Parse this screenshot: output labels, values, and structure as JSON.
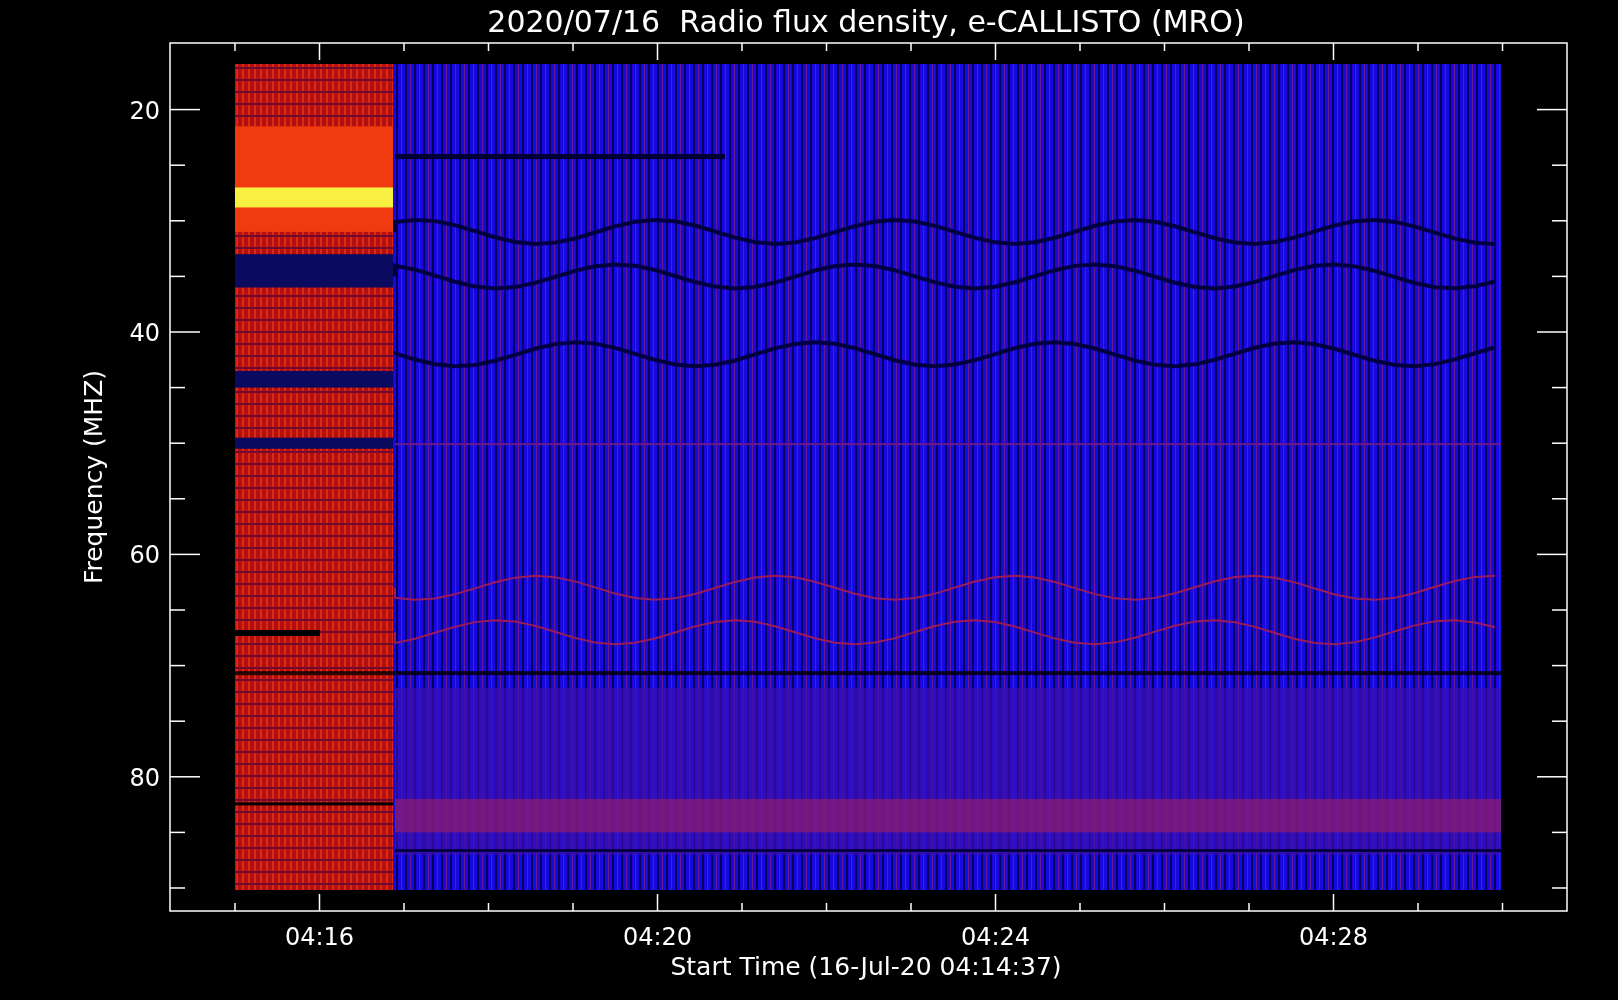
{
  "title": "2020/07/16  Radio flux density, e-CALLISTO (MRO)",
  "plot": {
    "xlabel": "Start Time (16-Jul-20 04:14:37)",
    "ylabel": "Frequency (MHZ)",
    "xticks": [
      {
        "label": "04:16"
      },
      {
        "label": "04:20"
      },
      {
        "label": "04:24"
      },
      {
        "label": "04:28"
      }
    ],
    "yticks": [
      {
        "label": "20"
      },
      {
        "label": "40"
      },
      {
        "label": "60"
      },
      {
        "label": "80"
      }
    ]
  }
}
